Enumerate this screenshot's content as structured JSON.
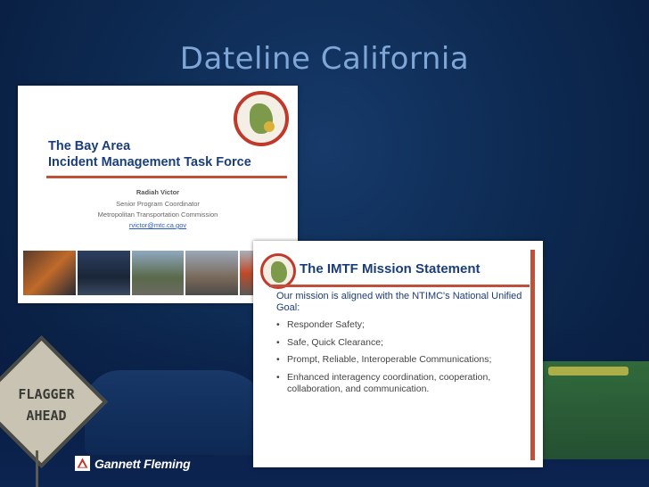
{
  "slide": {
    "title": "Dateline California"
  },
  "sign": {
    "line1": "FLAGGER",
    "line2": "AHEAD"
  },
  "card1": {
    "title_line1": "The Bay Area",
    "title_line2": "Incident Management Task Force",
    "name": "Radiah Victor",
    "role": "Senior Program Coordinator",
    "org": "Metropolitan Transportation Commission",
    "email": "rvictor@mtc.ca.gov"
  },
  "card2": {
    "title": "The IMTF Mission Statement",
    "intro": "Our mission is aligned with the NTIMC's National Unified Goal:",
    "bullets": [
      "Responder Safety;",
      "Safe, Quick Clearance;",
      "Prompt, Reliable, Interoperable Communications;",
      "Enhanced interagency coordination, cooperation, collaboration, and communication."
    ]
  },
  "brand": {
    "name": "Gannett Fleming"
  },
  "colors": {
    "background": "#0d2a52",
    "title": "#7ea6d6",
    "accent_red": "#c0503a",
    "heading_blue": "#1a3e7a"
  }
}
